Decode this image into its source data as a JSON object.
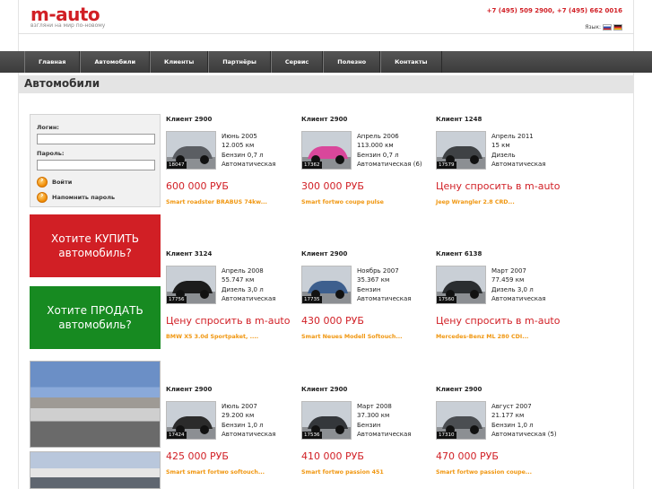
{
  "header": {
    "logo": "m-auto",
    "tagline": "взгляни на мир по-новому",
    "phones": "+7 (495) 509 2900, +7 (495) 662 0016",
    "lang_label": "Язык:"
  },
  "nav": [
    "Главная",
    "Автомобили",
    "Клиенты",
    "Партнёры",
    "Сервис",
    "Полезно",
    "Контакты"
  ],
  "page_title": "Автомобили",
  "login": {
    "login_label": "Логин:",
    "password_label": "Пароль:",
    "enter": "Войти",
    "remember": "Напомнить пароль"
  },
  "banners": {
    "buy": "Хотите КУПИТЬ автомобиль?",
    "sell": "Хотите ПРОДАТЬ автомобиль?"
  },
  "listings": [
    {
      "client": "Клиент 2900",
      "id": "18047",
      "date": "Июнь 2005",
      "km": "12.005 км",
      "engine": "Бензин 0,7 л",
      "gear": "Автоматическая",
      "price": "600 000 РУБ",
      "title": "Smart roadster BRABUS 74kw...",
      "color": "#5b5e63"
    },
    {
      "client": "Клиент 2900",
      "id": "17362",
      "date": "Апрель 2006",
      "km": "113.000 км",
      "engine": "Бензин 0,7 л",
      "gear": "Автоматическая (6)",
      "price": "300 000 РУБ",
      "title": "Smart fortwo coupe pulse",
      "color": "#d9479b"
    },
    {
      "client": "Клиент 1248",
      "id": "17579",
      "date": "Апрель 2011",
      "km": "15 км",
      "engine": "Дизель",
      "gear": "Автоматическая",
      "price": "Цену спросить в m-auto",
      "title": "Jeep Wrangler 2.8 CRD...",
      "color": "#3f4245"
    },
    {
      "client": "Клиент 3124",
      "id": "17756",
      "date": "Апрель 2008",
      "km": "55.747 км",
      "engine": "Дизель 3,0 л",
      "gear": "Автоматическая",
      "price": "Цену спросить в m-auto",
      "title": "BMW X5 3.0d Sportpaket, ....",
      "color": "#1c1c1c"
    },
    {
      "client": "Клиент 2900",
      "id": "17735",
      "date": "Ноябрь 2007",
      "km": "35.367 км",
      "engine": "Бензин",
      "gear": "Автоматическая",
      "price": "430 000 РУБ",
      "title": "Smart Neues Modell Softouch...",
      "color": "#3d5f8e"
    },
    {
      "client": "Клиент 6138",
      "id": "17560",
      "date": "Март 2007",
      "km": "77.459 км",
      "engine": "Дизель 3,0 л",
      "gear": "Автоматическая",
      "price": "Цену спросить в m-auto",
      "title": "Mercedes-Benz ML 280 CDI...",
      "color": "#2a2d30"
    },
    {
      "client": "Клиент 2900",
      "id": "17424",
      "date": "Июль 2007",
      "km": "29.200 км",
      "engine": "Бензин 1,0 л",
      "gear": "Автоматическая",
      "price": "425 000 РУБ",
      "title": "Smart smart fortwo softouch...",
      "color": "#2b2b2b"
    },
    {
      "client": "Клиент 2900",
      "id": "17536",
      "date": "Март 2008",
      "km": "37.300 км",
      "engine": "Бензин",
      "gear": "Автоматическая",
      "price": "410 000 РУБ",
      "title": "Smart fortwo passion 451",
      "color": "#34373b"
    },
    {
      "client": "Клиент 2900",
      "id": "17310",
      "date": "Август 2007",
      "km": "21.177 км",
      "engine": "Бензин 1,0 л",
      "gear": "Автоматическая (5)",
      "price": "470 000 РУБ",
      "title": "Smart fortwo passion coupe...",
      "color": "#4b4e52"
    }
  ]
}
